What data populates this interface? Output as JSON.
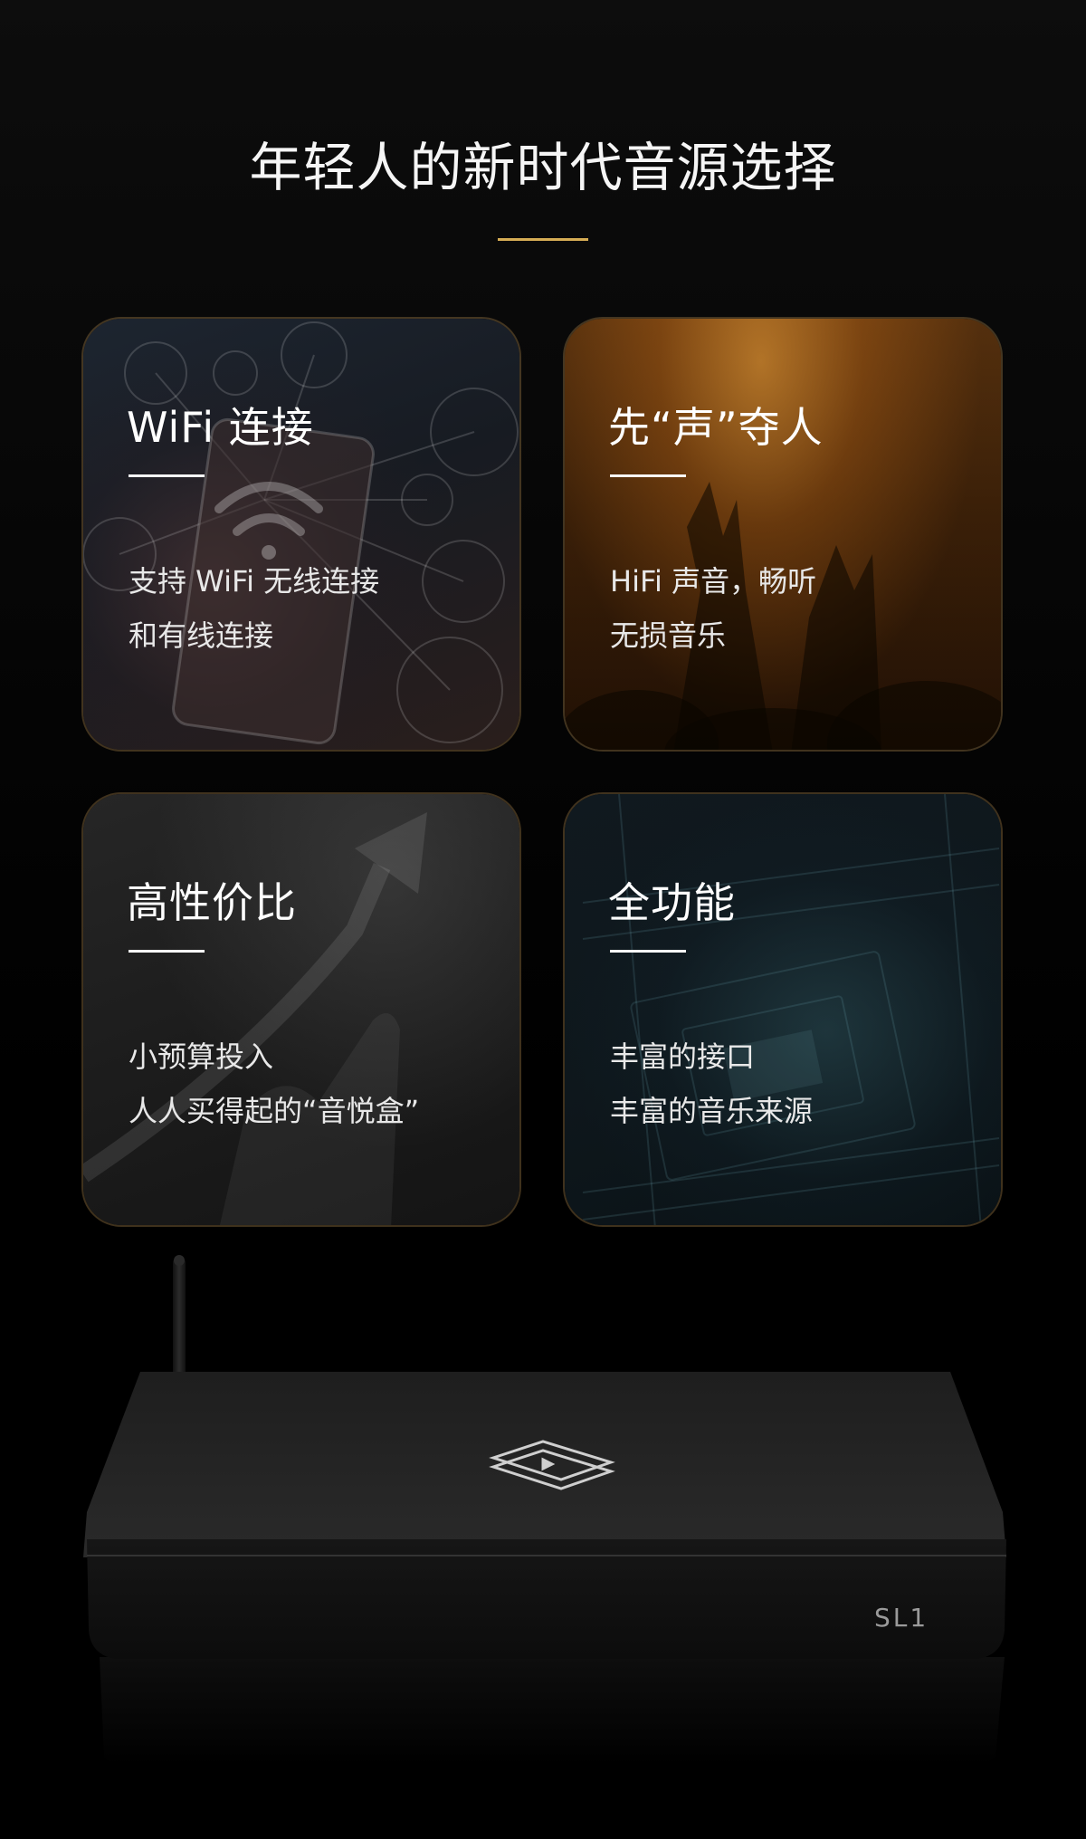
{
  "header": {
    "title": "年轻人的新时代音源选择"
  },
  "colors": {
    "accent": "#d6ad55",
    "background": "#000000",
    "text": "#ffffff"
  },
  "cards": [
    {
      "title": "WiFi 连接",
      "lines": [
        "支持 WiFi 无线连接",
        "和有线连接"
      ],
      "icon": "wifi-icon"
    },
    {
      "title": "先“声”夺人",
      "lines": [
        "HiFi 声音，畅听",
        "无损音乐"
      ],
      "icon": "concert-icon"
    },
    {
      "title": "高性价比",
      "lines": [
        "小预算投入",
        "人人买得起的“音悦盒”"
      ],
      "icon": "growth-arrow-icon"
    },
    {
      "title": "全功能",
      "lines": [
        "丰富的接口",
        "丰富的音乐来源"
      ],
      "icon": "circuit-board-icon"
    }
  ],
  "device": {
    "model_label": "SL1",
    "logo_icon": "play-hexagon-icon"
  }
}
